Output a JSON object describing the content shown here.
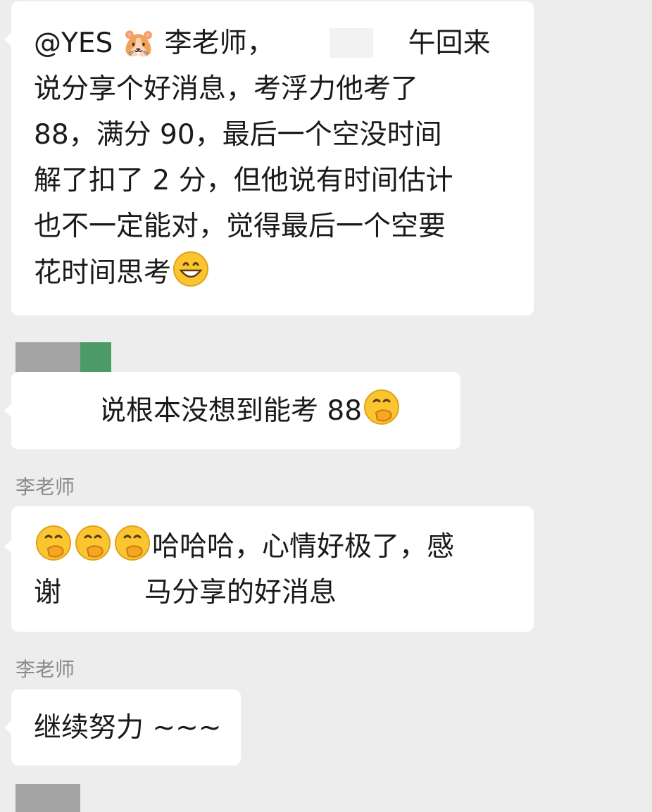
{
  "messages": [
    {
      "lines": [
        "@YES 🐹 李老师，",
        "午回来",
        "说分享个好消息，考浮力他考了",
        "88，满分 90，最后一个空没时间",
        "解了扣了 2 分，但他说有时间估计",
        "也不一定能对，觉得最后一个空要",
        "花时间思考"
      ]
    },
    {
      "text": "说根本没想到能考 88"
    },
    {
      "sender": "李老师",
      "lines": [
        "哈哈哈，心情好极了，感",
        "谢",
        "马分享的好消息"
      ]
    },
    {
      "sender": "李老师",
      "text": "继续努力 ~~~"
    }
  ],
  "icons": {
    "grin": "grinning-face-icon",
    "hand_over_mouth": "face-with-hand-over-mouth-icon",
    "hamster": "hamster-icon"
  },
  "colors": {
    "background": "#ededed",
    "bubble": "#ffffff",
    "text": "#1a1a1a",
    "sender": "#8a8a8a",
    "emoji_yellow": "#fbc531"
  }
}
